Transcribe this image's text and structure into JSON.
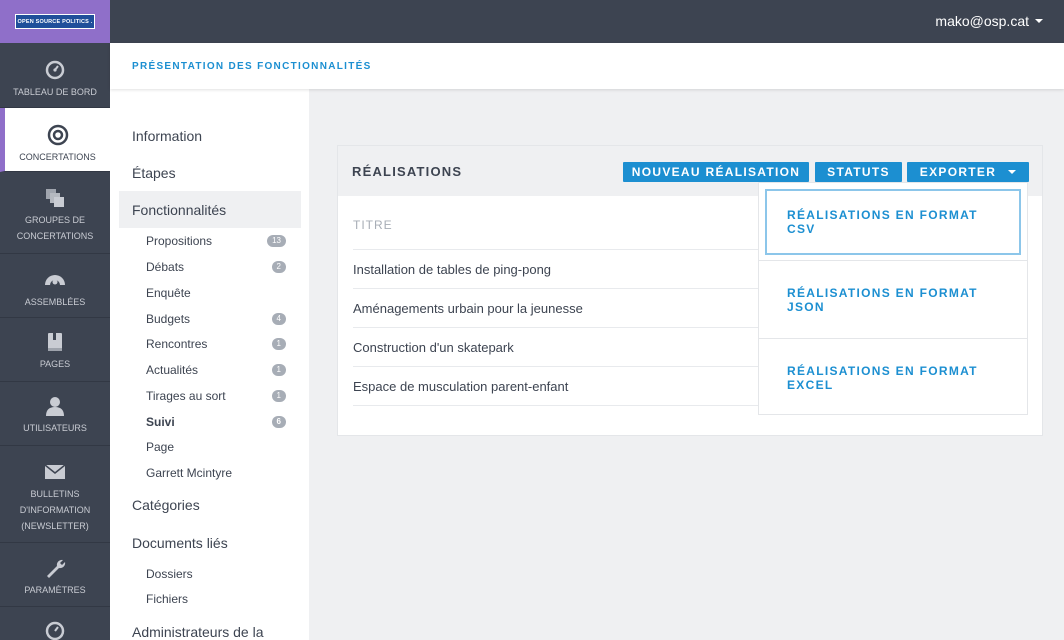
{
  "logo_text": "OPEN SOURCE POLITICS .",
  "nav": [
    {
      "label": "TABLEAU DE BORD",
      "icon": "dashboard-icon"
    },
    {
      "label": "CONCERTATIONS",
      "icon": "target-icon"
    },
    {
      "label": "GROUPES DE CONCERTATIONS",
      "icon": "layers-icon"
    },
    {
      "label": "ASSEMBLÉES",
      "icon": "assembly-icon"
    },
    {
      "label": "PAGES",
      "icon": "book-icon"
    },
    {
      "label": "UTILISATEURS",
      "icon": "user-icon"
    },
    {
      "label": "BULLETINS D'INFORMATION (NEWSLETTER)",
      "icon": "envelope-icon"
    },
    {
      "label": "PARAMÈTRES",
      "icon": "wrench-icon"
    }
  ],
  "user": {
    "email": "mako@osp.cat"
  },
  "page_title": "PRÉSENTATION DES FONCTIONNALITÉS",
  "secondary_nav": {
    "information": "Information",
    "etapes": "Étapes",
    "fonctionnalites": "Fonctionnalités",
    "sub": [
      {
        "label": "Propositions",
        "count": "13"
      },
      {
        "label": "Débats",
        "count": "2"
      },
      {
        "label": "Enquête",
        "count": ""
      },
      {
        "label": "Budgets",
        "count": "4"
      },
      {
        "label": "Rencontres",
        "count": "1"
      },
      {
        "label": "Actualités",
        "count": "1"
      },
      {
        "label": "Tirages au sort",
        "count": "1"
      },
      {
        "label": "Suivi",
        "count": "6"
      },
      {
        "label": "Page",
        "count": ""
      },
      {
        "label": "Garrett Mcintyre",
        "count": ""
      }
    ],
    "categories": "Catégories",
    "documents": "Documents liés",
    "documents_sub": [
      "Dossiers",
      "Fichiers"
    ],
    "admins": "Administrateurs de la"
  },
  "card": {
    "title": "RÉALISATIONS",
    "new_button": "NOUVEAU RÉALISATION",
    "statuts_button": "STATUTS",
    "export_button": "EXPORTER",
    "column_header": "TITRE",
    "rows": [
      "Installation de tables de ping-pong",
      "Aménagements urbain pour la jeunesse",
      "Construction d'un skatepark",
      "Espace de musculation parent-enfant"
    ]
  },
  "export_dropdown": [
    {
      "line1": "RÉALISATIONS EN FORMAT",
      "line2": "CSV"
    },
    {
      "line1": "RÉALISATIONS EN FORMAT",
      "line2": "JSON"
    },
    {
      "line1": "RÉALISATIONS EN FORMAT",
      "line2": "EXCEL"
    }
  ],
  "colors": {
    "accent": "#1c8fd1",
    "nav_bg": "#3d4451",
    "brand_purple": "#8f6fc9"
  }
}
